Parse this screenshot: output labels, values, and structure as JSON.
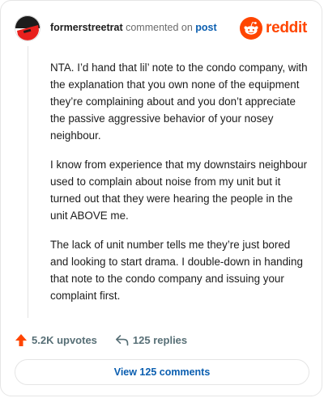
{
  "header": {
    "username": "formerstreetrat",
    "action_text": "commented on",
    "post_link": "post",
    "logo_word": "reddit"
  },
  "comment": {
    "paragraphs": [
      "NTA. I’d hand that lil’ note to the condo company, with the explanation that you own none of the equipment they’re complaining about and you don’t appreciate the passive aggressive behavior of your nosey neighbour.",
      "I know from experience that my downstairs neighbour used to complain about noise from my unit but it turned out that they were hearing the people in the unit ABOVE me.",
      "The lack of unit number tells me they’re just bored and looking to start drama. I double-down in handing that note to the condo company and issuing your complaint first."
    ]
  },
  "footer": {
    "upvotes": "5.2K upvotes",
    "replies": "125 replies"
  },
  "view_button": {
    "label": "View 125 comments"
  },
  "colors": {
    "accent_orange": "#ff4500",
    "link_blue": "#0a5eb0",
    "muted_gray": "#576f76"
  },
  "icons": {
    "avatar": "avatar-icon",
    "logo": "reddit-snoo-icon",
    "upvote": "upvote-arrow-icon",
    "reply": "reply-arrow-icon"
  }
}
